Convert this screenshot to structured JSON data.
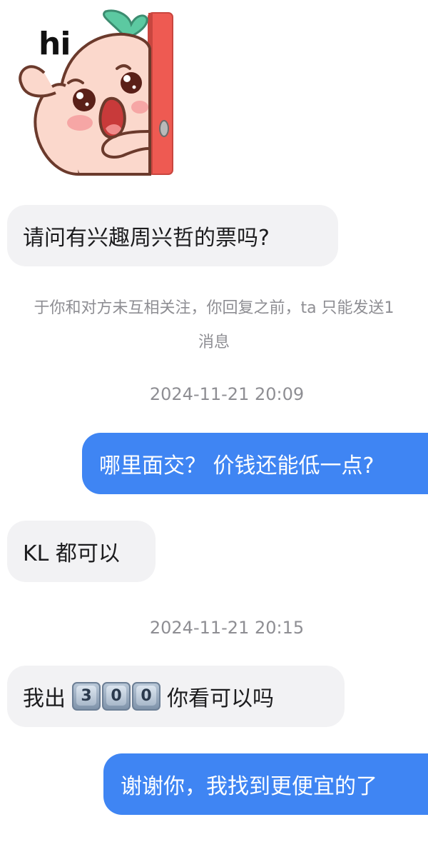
{
  "sticker": {
    "text": "hi",
    "colors": {
      "skin": "#fbd8cc",
      "outline": "#6b3a2c",
      "door": "#ee5a52",
      "leaf": "#5cc9a1",
      "cheek": "#f59d9d"
    }
  },
  "messages": [
    {
      "side": "incoming",
      "text": "请问有兴趣周兴哲的票吗?"
    },
    {
      "side": "outgoing",
      "text": "哪里面交？  价钱还能低一点?"
    },
    {
      "side": "incoming",
      "text": "KL 都可以"
    },
    {
      "side": "incoming",
      "prefix": "我出",
      "keycaps": [
        "3",
        "0",
        "0"
      ],
      "suffix": "你看可以吗"
    },
    {
      "side": "outgoing",
      "text": "谢谢你，我找到更便宜的了"
    }
  ],
  "system_notice": {
    "line1": "于你和对方未互相关注，你回复之前，ta 只能发送1",
    "line2": "消息"
  },
  "timestamps": [
    "2024-11-21 20:09",
    "2024-11-21 20:15"
  ],
  "colors": {
    "incoming_bubble": "#f2f2f4",
    "outgoing_bubble": "#3f85f3",
    "meta_text": "#8e8e93"
  }
}
